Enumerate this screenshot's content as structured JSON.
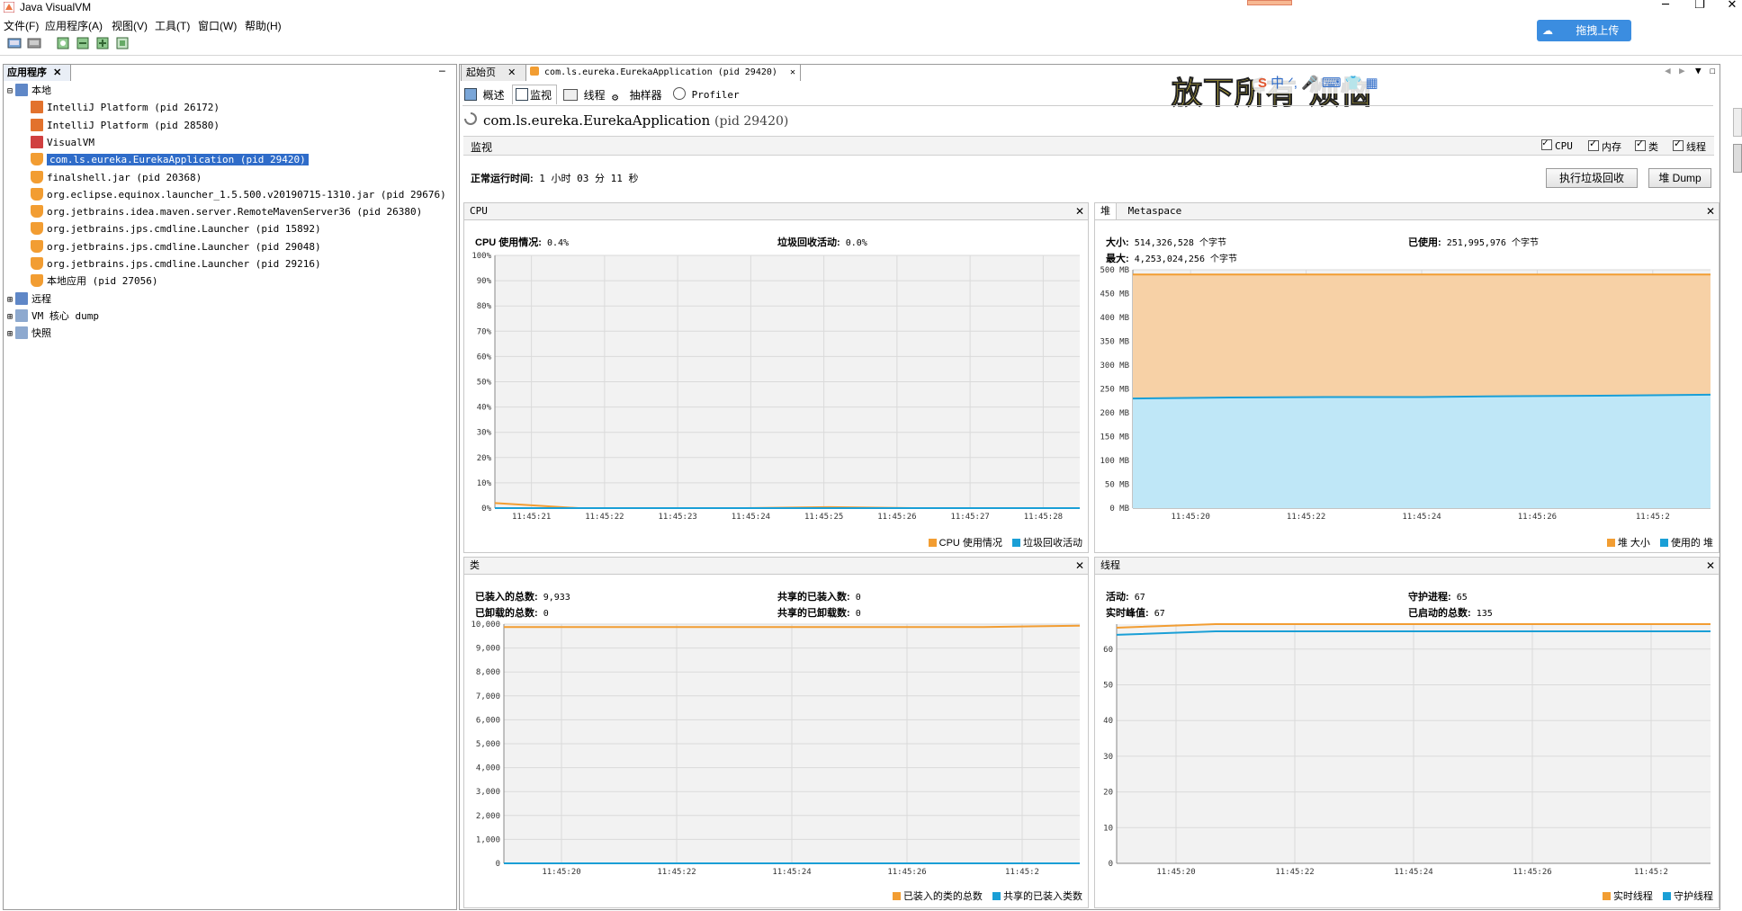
{
  "window": {
    "title": "Java VisualVM",
    "controls": [
      "─",
      "❐",
      "✕"
    ]
  },
  "menu": [
    "文件(F)",
    "应用程序(A)",
    "视图(V)",
    "工具(T)",
    "窗口(W)",
    "帮助(H)"
  ],
  "overlay": {
    "upload_label": "拖拽上传",
    "ime_banner": "放下所有 烦恼"
  },
  "left_panel": {
    "tab_label": "应用程序",
    "minimize": "─",
    "tree": [
      {
        "label": "本地",
        "level": 0,
        "icon": "computer-icon"
      },
      {
        "label": "IntelliJ Platform (pid 26172)",
        "level": 1,
        "icon": "intellij-icon"
      },
      {
        "label": "IntelliJ Platform (pid 28580)",
        "level": 1,
        "icon": "intellij-icon"
      },
      {
        "label": "VisualVM",
        "level": 1,
        "icon": "visualvm-icon"
      },
      {
        "label": "com.ls.eureka.EurekaApplication (pid 29420)",
        "level": 1,
        "icon": "java-icon",
        "selected": true
      },
      {
        "label": "finalshell.jar (pid 20368)",
        "level": 1,
        "icon": "java-icon"
      },
      {
        "label": "org.eclipse.equinox.launcher_1.5.500.v20190715-1310.jar (pid 29676)",
        "level": 1,
        "icon": "java-icon"
      },
      {
        "label": "org.jetbrains.idea.maven.server.RemoteMavenServer36 (pid 26380)",
        "level": 1,
        "icon": "java-icon"
      },
      {
        "label": "org.jetbrains.jps.cmdline.Launcher (pid 15892)",
        "level": 1,
        "icon": "java-icon"
      },
      {
        "label": "org.jetbrains.jps.cmdline.Launcher (pid 29048)",
        "level": 1,
        "icon": "java-icon"
      },
      {
        "label": "org.jetbrains.jps.cmdline.Launcher (pid 29216)",
        "level": 1,
        "icon": "java-icon"
      },
      {
        "label": "本地应用 (pid 27056)",
        "level": 1,
        "icon": "java-icon"
      },
      {
        "label": "远程",
        "level": 0,
        "icon": "remote-icon"
      },
      {
        "label": "VM 核心 dump",
        "level": 0,
        "icon": "coredump-icon"
      },
      {
        "label": "快照",
        "level": 0,
        "icon": "snapshot-icon"
      }
    ]
  },
  "doc_tabs": [
    {
      "label": "起始页",
      "close": "✕"
    },
    {
      "label": "com.ls.eureka.EurekaApplication (pid 29420)",
      "close": "✕"
    }
  ],
  "sub_tabs": [
    "概述",
    "监视",
    "线程",
    "抽样器",
    "Profiler"
  ],
  "app": {
    "name": "com.ls.eureka.EurekaApplication",
    "pid": "(pid 29420)",
    "section": "监视",
    "checks": [
      "CPU",
      "内存",
      "类",
      "线程"
    ],
    "uptime_label": "正常运行时间:",
    "uptime_value": "1 小时 03 分 11 秒",
    "gc_button": "执行垃圾回收",
    "dump_button": "堆 Dump"
  },
  "chart_data": [
    {
      "id": "cpu",
      "type": "line",
      "title": "CPU",
      "stats": [
        {
          "label": "CPU 使用情况:",
          "value": "0.4%"
        },
        {
          "label": "垃圾回收活动:",
          "value": "0.0%"
        }
      ],
      "ytick_labels": [
        "100%",
        "90%",
        "80%",
        "70%",
        "60%",
        "50%",
        "40%",
        "30%",
        "20%",
        "10%",
        "0%"
      ],
      "ylim": [
        0,
        100
      ],
      "x": [
        "11:45:21",
        "11:45:22",
        "11:45:23",
        "11:45:24",
        "11:45:25",
        "11:45:26",
        "11:45:27",
        "11:45:28"
      ],
      "series": [
        {
          "name": "CPU 使用情况",
          "color": "#f29d32",
          "values": [
            2.0,
            0.0,
            0.0,
            0.0,
            0.4,
            0.0,
            0.0,
            0.0
          ]
        },
        {
          "name": "垃圾回收活动",
          "color": "#1a9fd6",
          "values": [
            0,
            0,
            0,
            0,
            0,
            0,
            0,
            0
          ]
        }
      ],
      "grid": true
    },
    {
      "id": "heap",
      "type": "area",
      "tabs": [
        "堆",
        "Metaspace"
      ],
      "stats": [
        {
          "label": "大小:",
          "value": "514,326,528 个字节"
        },
        {
          "label": "已使用:",
          "value": "251,995,976 个字节"
        },
        {
          "label": "最大:",
          "value": "4,253,024,256 个字节"
        }
      ],
      "ytick_labels": [
        "500 MB",
        "450 MB",
        "400 MB",
        "350 MB",
        "300 MB",
        "250 MB",
        "200 MB",
        "150 MB",
        "100 MB",
        "50 MB",
        "0 MB"
      ],
      "ylim": [
        0,
        500
      ],
      "xtick_labels": [
        "11:45:20",
        "11:45:22",
        "11:45:24",
        "11:45:26",
        "11:45:2"
      ],
      "series": [
        {
          "name": "堆 大小",
          "color": "#f29d32",
          "fill": "#f7d1a6",
          "values": [
            490,
            490,
            490,
            490,
            490,
            490,
            490
          ]
        },
        {
          "name": "使用的 堆",
          "color": "#1a9fd6",
          "fill": "#bfe7f7",
          "values": [
            230,
            232,
            233,
            233,
            235,
            236,
            238
          ]
        }
      ],
      "grid": true
    },
    {
      "id": "classes",
      "type": "line",
      "title": "类",
      "stats": [
        {
          "label": "已装入的总数:",
          "value": "9,933"
        },
        {
          "label": "共享的已装入数:",
          "value": "0"
        },
        {
          "label": "已卸载的总数:",
          "value": "0"
        },
        {
          "label": "共享的已卸载数:",
          "value": "0"
        }
      ],
      "ytick_labels": [
        "10,000",
        "9,000",
        "8,000",
        "7,000",
        "6,000",
        "5,000",
        "4,000",
        "3,000",
        "2,000",
        "1,000",
        "0"
      ],
      "ylim": [
        0,
        10000
      ],
      "xtick_labels": [
        "11:45:20",
        "11:45:22",
        "11:45:24",
        "11:45:26",
        "11:45:2"
      ],
      "series": [
        {
          "name": "已装入的类的总数",
          "color": "#f29d32",
          "values": [
            9880,
            9880,
            9880,
            9880,
            9880,
            9880,
            9933
          ]
        },
        {
          "name": "共享的已装入类数",
          "color": "#1a9fd6",
          "values": [
            0,
            0,
            0,
            0,
            0,
            0,
            0
          ]
        }
      ],
      "grid": true
    },
    {
      "id": "threads",
      "type": "line",
      "title": "线程",
      "stats": [
        {
          "label": "活动:",
          "value": "67"
        },
        {
          "label": "守护进程:",
          "value": "65"
        },
        {
          "label": "实时峰值:",
          "value": "67"
        },
        {
          "label": "已启动的总数:",
          "value": "135"
        }
      ],
      "ytick_labels": [
        "60",
        "50",
        "40",
        "30",
        "20",
        "10",
        "0"
      ],
      "ylim": [
        0,
        67
      ],
      "xtick_labels": [
        "11:45:20",
        "11:45:22",
        "11:45:24",
        "11:45:26",
        "11:45:2"
      ],
      "series": [
        {
          "name": "实时线程",
          "color": "#f29d32",
          "values": [
            66,
            67,
            67,
            67,
            67,
            67,
            67
          ]
        },
        {
          "name": "守护线程",
          "color": "#1a9fd6",
          "values": [
            64,
            65,
            65,
            65,
            65,
            65,
            65
          ]
        }
      ],
      "grid": true
    }
  ]
}
